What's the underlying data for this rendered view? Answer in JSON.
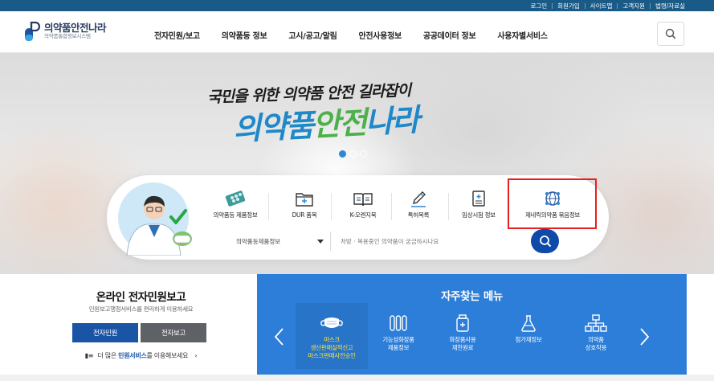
{
  "topbar": {
    "links": [
      "로그인",
      "회원가입",
      "사이트맵",
      "고객지원",
      "법령/자료실"
    ]
  },
  "header": {
    "logo_title": "의약품안전나라",
    "logo_subtitle": "의약품통합정보시스템",
    "nav": [
      "전자민원/보고",
      "의약품등 정보",
      "고시/공고/알림",
      "안전사용정보",
      "공공데이터 정보",
      "사용자별서비스"
    ],
    "search_icon": "search-icon"
  },
  "hero": {
    "line1": "국민을 위한 의약품 안전 길라잡이",
    "line2_blue": "의약품",
    "line2_green": "안전",
    "line2_blue2": "나라",
    "slide_count": 3,
    "active_slide": 1
  },
  "services": {
    "items": [
      {
        "label": "의약품등 제품정보",
        "icon": "pill-pack-icon"
      },
      {
        "label": "DUR 품목",
        "icon": "medical-folder-icon"
      },
      {
        "label": "K-오렌지북",
        "icon": "open-book-icon"
      },
      {
        "label": "특허목록",
        "icon": "pencil-edit-icon"
      },
      {
        "label": "임상시험 정보",
        "icon": "clinical-document-icon"
      },
      {
        "label": "제네릭의약품 묶음정보",
        "icon": "globe-network-icon"
      }
    ],
    "search_select_value": "의약품등제품정보",
    "search_placeholder": "처방 · 복용중인 의약품이 궁금하시나요"
  },
  "online_report": {
    "title": "온라인 전자민원보고",
    "subtitle": "민원보고행정서비스를 편리하게 이용하세요",
    "button1": "전자민원",
    "button2": "전자보고",
    "more_prefix": "더 많은",
    "more_highlight": "민원서비스",
    "more_suffix": "를 이용해보세요",
    "more_chevron": "›"
  },
  "frequent_menu": {
    "title": "자주찾는 메뉴",
    "items": [
      {
        "label_lines": [
          "마스크",
          "생산판매실적신고",
          "마스크판매사전승인"
        ],
        "icon": "mask-icon"
      },
      {
        "label_lines": [
          "기능성화장품",
          "제품정보"
        ],
        "icon": "test-tubes-icon"
      },
      {
        "label_lines": [
          "화장품사용",
          "제한원료"
        ],
        "icon": "bottle-icon"
      },
      {
        "label_lines": [
          "첨가제정보"
        ],
        "icon": "flask-icon"
      },
      {
        "label_lines": [
          "의약품",
          "상호작용"
        ],
        "icon": "hierarchy-icon"
      }
    ]
  },
  "colors": {
    "topbar": "#1a5a87",
    "primary_blue": "#1a55a5",
    "menu_blue": "#2d7ed8",
    "highlight_red": "#e32121",
    "accent_yellow": "#ffe43a"
  }
}
